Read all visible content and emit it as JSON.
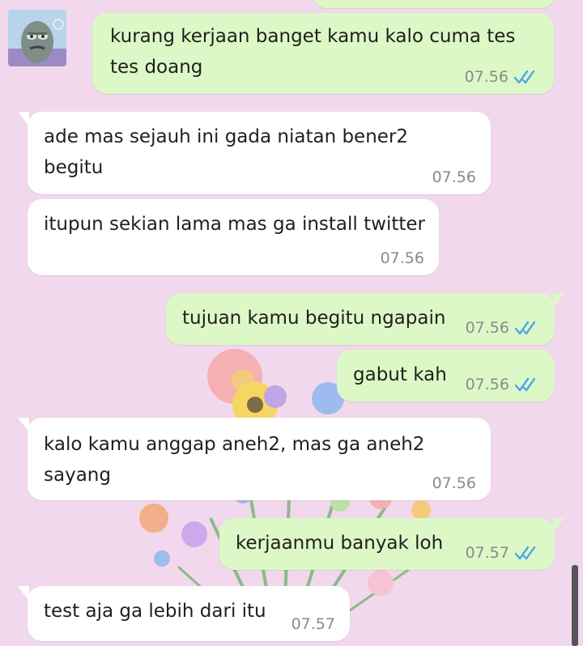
{
  "colors": {
    "background": "#f1d8ec",
    "incoming_bubble": "#ffffff",
    "outgoing_bubble": "#dcf8c6",
    "read_ticks": "#4fa7e8",
    "timestamp": "#8a8a8a"
  },
  "chat": {
    "avatar_icon": "gray-character-avatar",
    "messages": [
      {
        "direction": "out",
        "lines": [
          "kurang kerjaan banget kamu kalo cuma tes",
          "tes doang"
        ],
        "time": "07.56",
        "status": "read-double-check"
      },
      {
        "direction": "in",
        "lines": [
          "ade mas sejauh ini gada niatan bener2",
          "begitu"
        ],
        "time": "07.56"
      },
      {
        "direction": "in",
        "lines": [
          "itupun sekian lama mas ga install twitter"
        ],
        "time": "07.56"
      },
      {
        "direction": "out",
        "lines": [
          "tujuan kamu begitu ngapain"
        ],
        "time": "07.56",
        "status": "read-double-check"
      },
      {
        "direction": "out",
        "lines": [
          "gabut kah"
        ],
        "time": "07.56",
        "status": "read-double-check"
      },
      {
        "direction": "in",
        "lines": [
          "kalo kamu anggap aneh2, mas ga aneh2",
          "sayang"
        ],
        "time": "07.56"
      },
      {
        "direction": "out",
        "lines": [
          "kerjaanmu banyak loh"
        ],
        "time": "07.57",
        "status": "read-double-check"
      },
      {
        "direction": "in",
        "lines": [
          "test aja ga lebih dari itu"
        ],
        "time": "07.57"
      }
    ]
  }
}
